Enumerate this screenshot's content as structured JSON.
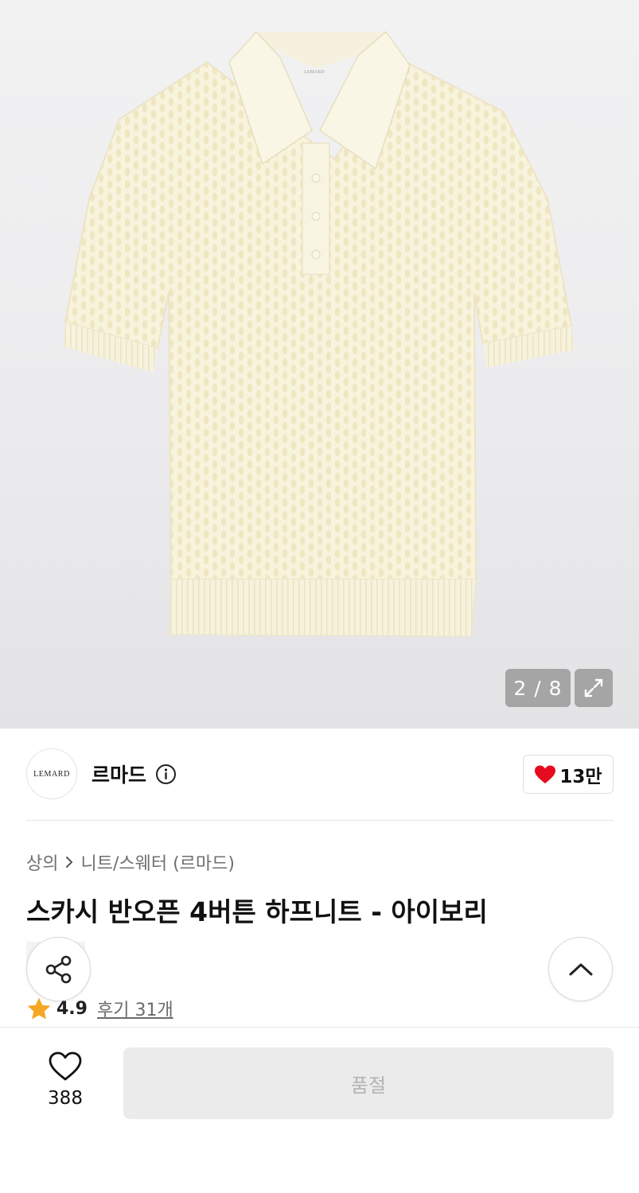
{
  "gallery": {
    "counter": "2 / 8",
    "image_alt": "product-photo",
    "garment_label": "LEMARD",
    "expand_icon": "expand-icon"
  },
  "brand": {
    "logo_text": "LEMARD",
    "name": "르마드",
    "info_icon": "info-icon",
    "like_count": "13만",
    "like_icon_color": "#e60b1e"
  },
  "breadcrumb": {
    "level1": "상의",
    "separator_icon": "chevron-right-icon",
    "level2": "니트/스웨터 (르마드)"
  },
  "product": {
    "title": "스카시 반오픈 4버튼 하프니트 - 아이보리"
  },
  "rating": {
    "score": "4.9",
    "reviews": "후기 31개",
    "star_color": "#f5a623"
  },
  "bottom": {
    "wish_count": "388",
    "soldout_label": "품절"
  }
}
